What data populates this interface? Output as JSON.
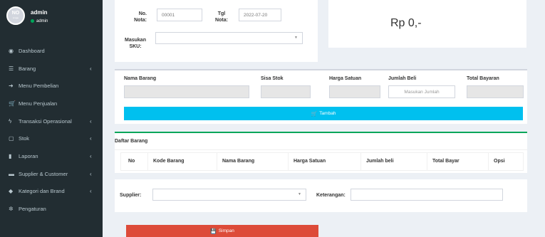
{
  "user": {
    "avatar_text": "NO",
    "avatar_sub": "image",
    "name": "admin",
    "status": "admin"
  },
  "sidebar": {
    "items": [
      {
        "label": "Dashboard",
        "icon": "dashboard-icon",
        "glyph": "◉",
        "chevron": ""
      },
      {
        "label": "Barang",
        "icon": "list-icon",
        "glyph": "☰",
        "chevron": "‹"
      },
      {
        "label": "Menu Pembelian",
        "icon": "sign-in-icon",
        "glyph": "➜",
        "chevron": ""
      },
      {
        "label": "Menu Penjualan",
        "icon": "cart-icon",
        "glyph": "🛒",
        "chevron": ""
      },
      {
        "label": "Transaksi Operasional",
        "icon": "bolt-icon",
        "glyph": "ϟ",
        "chevron": "‹"
      },
      {
        "label": "Stok",
        "icon": "square-icon",
        "glyph": "▢",
        "chevron": "‹"
      },
      {
        "label": "Laporan",
        "icon": "bar-chart-icon",
        "glyph": "▮",
        "chevron": "‹"
      },
      {
        "label": "Supplier & Customer",
        "icon": "truck-icon",
        "glyph": "▬",
        "chevron": "‹"
      },
      {
        "label": "Kategori dan Brand",
        "icon": "tag-icon",
        "glyph": "◆",
        "chevron": "‹"
      },
      {
        "label": "Pengaturan",
        "icon": "gear-icon",
        "glyph": "✲",
        "chevron": ""
      }
    ]
  },
  "header": {
    "no_nota_label_1": "No.",
    "no_nota_label_2": "Nota:",
    "no_nota_value": "00001",
    "tgl_label_1": "Tgl",
    "tgl_label_2": "Nota:",
    "tgl_value": "2022-07-20",
    "sku_label_1": "Masukan",
    "sku_label_2": "SKU:",
    "total": "Rp 0,-"
  },
  "item_form": {
    "nama_barang": "Nama Barang",
    "sisa_stok": "Sisa Stok",
    "harga_satuan": "Harga Satuan",
    "jumlah_beli": "Jumlah Beli",
    "jumlah_placeholder": "Masukan Jumlah",
    "total_bayaran": "Total Bayaran",
    "tambah": "Tambah"
  },
  "daftar": {
    "title": "Daftar Barang",
    "columns": [
      "No",
      "Kode Barang",
      "Nama Barang",
      "Harga Satuan",
      "Jumlah beli",
      "Total Bayar",
      "Opsi"
    ]
  },
  "footer": {
    "supplier_label": "Supplier:",
    "keterangan_label": "Keterangan:",
    "simpan": "Simpan"
  },
  "colors": {
    "sidebar": "#222d32",
    "accent_blue": "#00c0ef",
    "danger": "#dd4b39",
    "success": "#00a65a"
  }
}
